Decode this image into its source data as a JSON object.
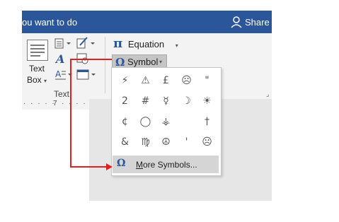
{
  "titlebar": {
    "tell_me": "ou want to do",
    "share_label": "Share"
  },
  "ribbon": {
    "textbox_label_line1": "Text",
    "textbox_label_line2": "Box",
    "group_text_label": "Text",
    "equation_label": "Equation",
    "symbol_label": "Symbol"
  },
  "ruler": {
    "mark": "7"
  },
  "symbols": {
    "items": [
      "⚡",
      "⚠",
      "£",
      "☹",
      "\"",
      "2",
      "#",
      "☿",
      "☽",
      "☀",
      "¢",
      "◯",
      "⚶",
      "",
      "†",
      "&",
      "♍",
      "☮",
      "'",
      "☹"
    ],
    "more_label": "More Symbols..."
  },
  "annotation": {
    "arrow_color": "#e02020"
  },
  "colors": {
    "accent": "#2b579a"
  }
}
